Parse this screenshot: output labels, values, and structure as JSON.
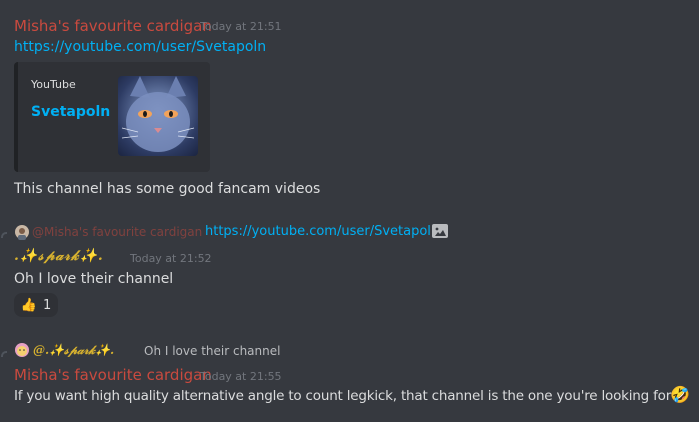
{
  "message1": {
    "author": "Misha's favourite cardigan",
    "timestamp": "Today at 21:51",
    "link": "https://youtube.com/user/Svetapoln",
    "embed": {
      "provider": "YouTube",
      "title": "Svetapoln",
      "thumbnail_icon": "cat-thumbnail-icon"
    },
    "text": "This channel has some good fancam videos"
  },
  "message2": {
    "reply": {
      "author": "@Misha's favourite cardigan",
      "link": "https://youtube.com/user/Svetapoln",
      "attachment_icon": "image-icon"
    },
    "author": ".✨𝓈𝓅𝒶𝓇𝓀✨.",
    "timestamp": "Today at 21:52",
    "text": "Oh I love their channel",
    "reaction": {
      "emoji": "👍",
      "count": "1"
    }
  },
  "message3": {
    "reply": {
      "author": "@.✨𝓈𝓅𝒶𝓇𝓀✨.",
      "text": "Oh I love their channel"
    },
    "author": "Misha's favourite cardigan",
    "timestamp": "Today at 21:55",
    "text": "If you want high quality alternative angle to count legkick, that channel is the one you're looking for",
    "emoji": "🤣"
  },
  "colors": {
    "background": "#36393f",
    "author_red": "#c94a3f",
    "link_blue": "#00b0f4",
    "spark_gold": "#d8b22f"
  }
}
